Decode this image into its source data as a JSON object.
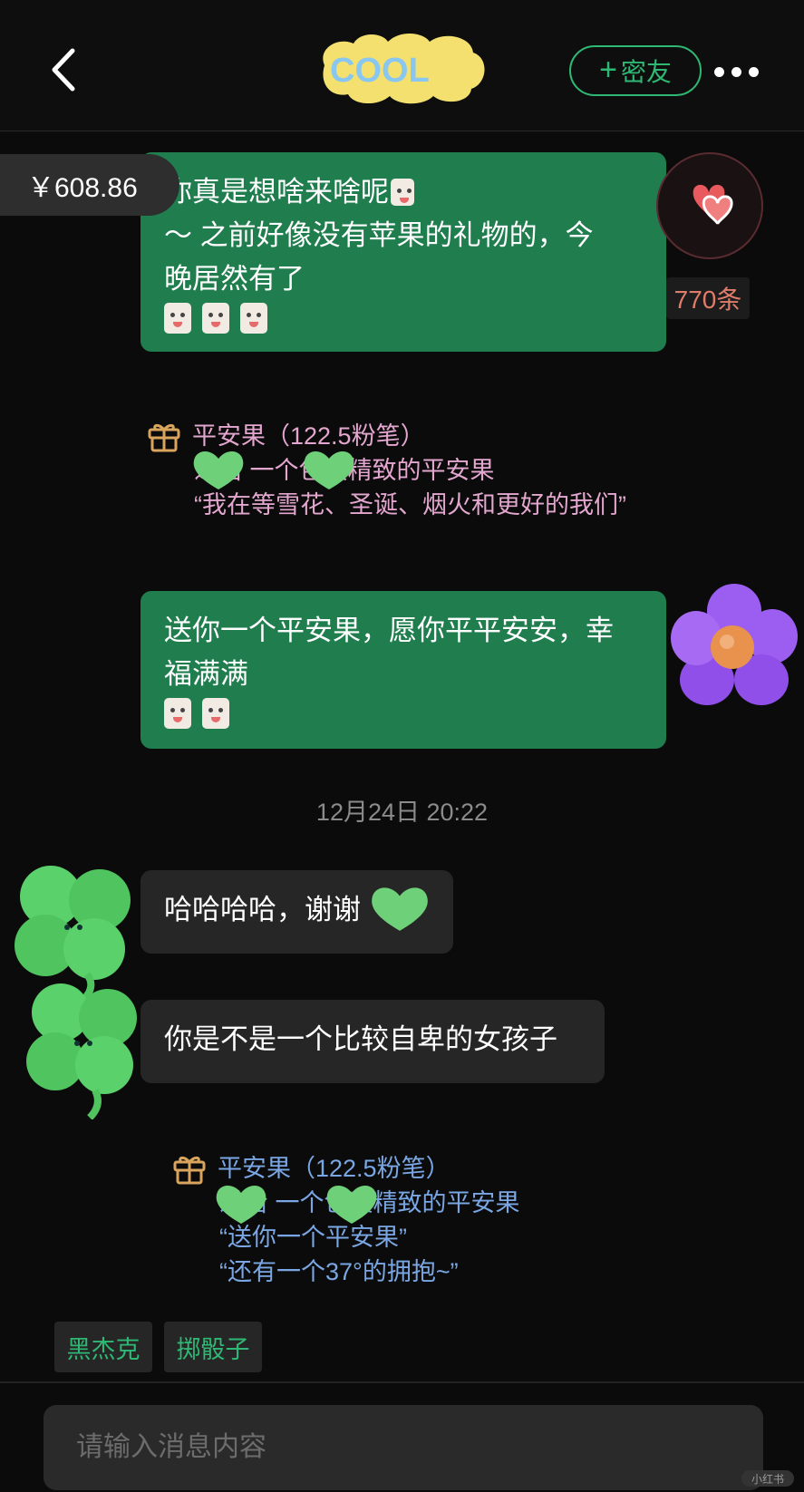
{
  "header": {
    "logo_text": "COOL",
    "add_friend_label": "密友",
    "add_friend_plus": "+"
  },
  "balance": "￥608.86",
  "message_count": "770条",
  "messages": [
    {
      "line1": "你真是想啥来啥呢",
      "line2": "～ 之前好像没有苹果的礼物的，今",
      "line3": "晚居然有了"
    },
    {
      "line1": "送你一个平安果，愿你平平安安，幸",
      "line2": "福满满"
    }
  ],
  "gift1": {
    "title": "平安果（122.5粉笔）",
    "line1": "递给  一个包装精致的平安果",
    "line2": "“我在等雪花、圣诞、烟火和更好的我们”"
  },
  "timestamp": "12月24日 20:22",
  "replies": [
    {
      "text": "哈哈哈哈，谢谢"
    },
    {
      "text": "你是不是一个比较自卑的女孩子"
    }
  ],
  "gift2": {
    "title": "平安果（122.5粉笔）",
    "line1": "递给  一个包装精致的平安果",
    "line2": "“送你一个平安果”",
    "line3": "“还有一个37°的拥抱~”"
  },
  "games": [
    "黑杰克",
    "掷骰子"
  ],
  "input": {
    "placeholder": "请输入消息内容"
  },
  "watermark": "小红书",
  "colors": {
    "background": "#0b0b0b",
    "my_bubble": "#1f7d4e",
    "their_bubble": "#262626",
    "accent_green": "#2fb874",
    "gift_pink": "#e3a7cf",
    "gift_blue": "#7aa6e3"
  }
}
